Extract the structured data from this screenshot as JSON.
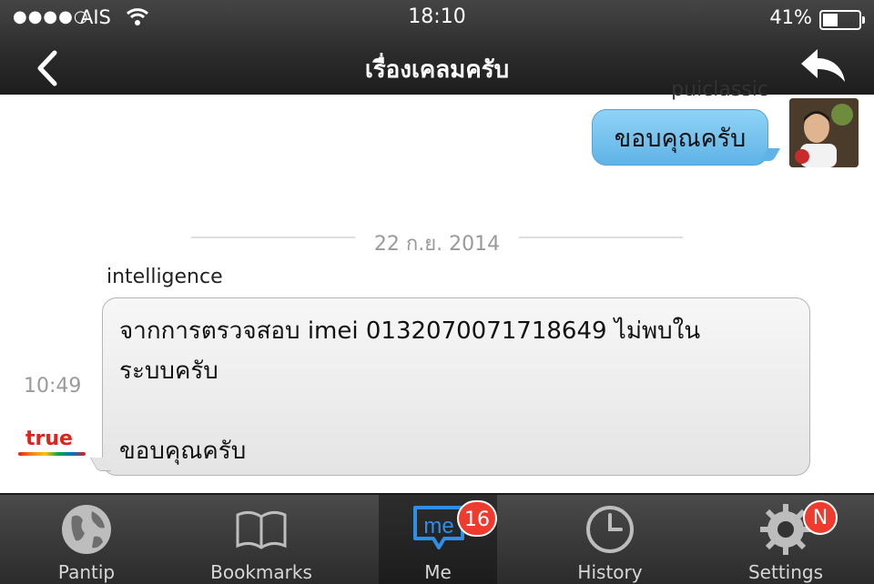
{
  "status_bar": {
    "signal": "●●●●○",
    "carrier": "AIS",
    "time": "18:10",
    "battery_percent": "41%",
    "battery_level": 0.41
  },
  "nav": {
    "title": "เรื่องเคลมครับ",
    "back_icon": "chevron-left-icon",
    "reply_icon": "reply-arrow-icon"
  },
  "messages": [
    {
      "side": "right",
      "username": "puiclassic",
      "text": "ขอบคุณครับ",
      "bubble_color": "#6cc0ee"
    },
    {
      "side": "left",
      "date_separator": "22 ก.ย. 2014",
      "username": "intelligence",
      "time": "10:49",
      "logo_text": "true",
      "lines": [
        "จากการตรวจสอบ imei 013207007171​8649 ไม่พบใน",
        "ระบบครับ",
        "ขอบคุณครับ"
      ]
    }
  ],
  "tabbar": {
    "tabs": [
      {
        "label": "Pantip",
        "icon": "globe-icon"
      },
      {
        "label": "Bookmarks",
        "icon": "book-icon"
      },
      {
        "label": "Me",
        "icon": "me-chat-icon",
        "badge": "16",
        "active": true
      },
      {
        "label": "History",
        "icon": "clock-icon"
      },
      {
        "label": "Settings",
        "icon": "gear-icon",
        "badge": "N"
      }
    ]
  },
  "colors": {
    "accent_blue": "#2f8fe8",
    "badge_red": "#ef3b2d",
    "bar_dark": "#2a2a2a"
  }
}
